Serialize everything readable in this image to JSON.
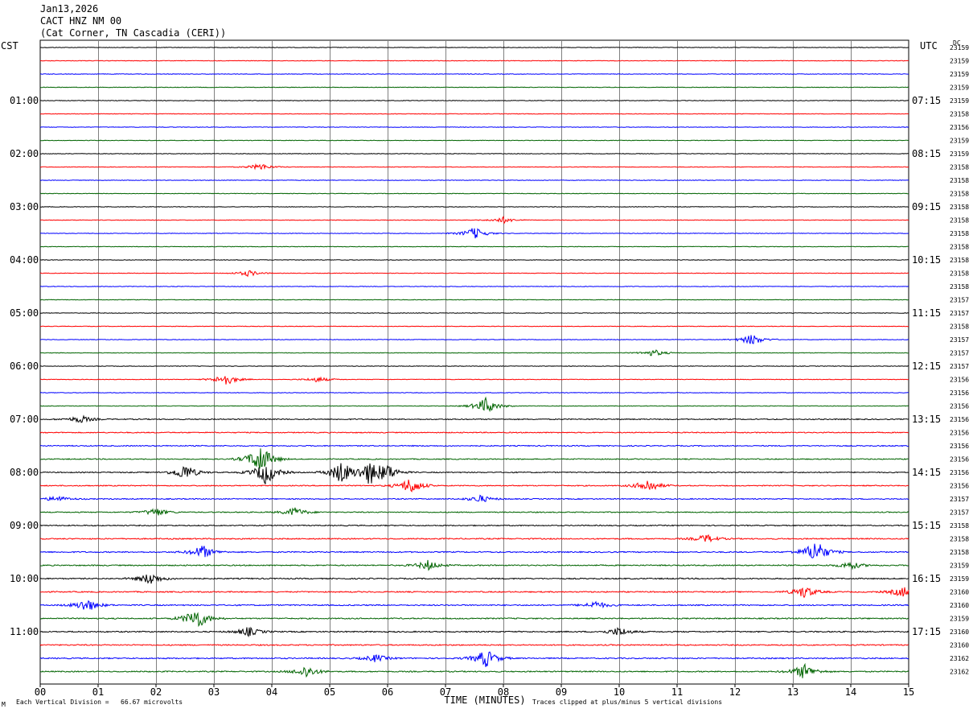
{
  "header": {
    "date": "Jan13,2026",
    "station": "CACT HNZ NM 00",
    "location": "(Cat Corner, TN Cascadia (CERI))"
  },
  "left_axis_label": "CST",
  "right_axis_label": "UTC",
  "dc_label": "DC",
  "footer": {
    "scale_note": "Each Vertical Division =   66.67 microvolts",
    "clip_note": "Traces clipped at plus/minus 5 vertical divisions",
    "corner_mark": "M"
  },
  "colors": {
    "trace_cycle": [
      "#000000",
      "#ff0000",
      "#0000ff",
      "#006400"
    ],
    "grid": "#808080",
    "background": "#ffffff"
  },
  "chart_data": {
    "type": "line",
    "title": "CACT HNZ NM 00",
    "xlabel": "TIME (MINUTES)",
    "ylabel": "",
    "xlim": [
      0,
      15
    ],
    "x_ticks": [
      "00",
      "01",
      "02",
      "03",
      "04",
      "05",
      "06",
      "07",
      "08",
      "09",
      "10",
      "11",
      "12",
      "13",
      "14",
      "15"
    ],
    "trace_count": 48,
    "left_hour_labels": [
      {
        "row": 4,
        "label": "01:00"
      },
      {
        "row": 8,
        "label": "02:00"
      },
      {
        "row": 12,
        "label": "03:00"
      },
      {
        "row": 16,
        "label": "04:00"
      },
      {
        "row": 20,
        "label": "05:00"
      },
      {
        "row": 24,
        "label": "06:00"
      },
      {
        "row": 28,
        "label": "07:00"
      },
      {
        "row": 32,
        "label": "08:00"
      },
      {
        "row": 36,
        "label": "09:00"
      },
      {
        "row": 40,
        "label": "10:00"
      },
      {
        "row": 44,
        "label": "11:00"
      }
    ],
    "right_hour_labels": [
      {
        "row": 4,
        "label": "07:15"
      },
      {
        "row": 8,
        "label": "08:15"
      },
      {
        "row": 12,
        "label": "09:15"
      },
      {
        "row": 16,
        "label": "10:15"
      },
      {
        "row": 20,
        "label": "11:15"
      },
      {
        "row": 24,
        "label": "12:15"
      },
      {
        "row": 28,
        "label": "13:15"
      },
      {
        "row": 32,
        "label": "14:15"
      },
      {
        "row": 36,
        "label": "15:15"
      },
      {
        "row": 40,
        "label": "16:15"
      },
      {
        "row": 44,
        "label": "17:15"
      }
    ],
    "dc_offsets": [
      "23159",
      "23159",
      "23159",
      "23159",
      "23159",
      "23158",
      "23156",
      "23159",
      "23159",
      "23158",
      "23158",
      "23158",
      "23158",
      "23158",
      "23158",
      "23158",
      "23158",
      "23158",
      "23158",
      "23157",
      "23157",
      "23158",
      "23157",
      "23157",
      "23157",
      "23156",
      "23156",
      "23156",
      "23156",
      "23156",
      "23156",
      "23156",
      "23156",
      "23156",
      "23157",
      "23157",
      "23158",
      "23158",
      "23158",
      "23159",
      "23159",
      "23160",
      "23160",
      "23159",
      "23160",
      "23160",
      "23162",
      "23162"
    ],
    "events": [
      {
        "row": 9,
        "minute": 3.8,
        "amp": 0.9
      },
      {
        "row": 13,
        "minute": 8.0,
        "amp": 0.8
      },
      {
        "row": 14,
        "minute": 7.5,
        "amp": 1.6
      },
      {
        "row": 17,
        "minute": 3.6,
        "amp": 0.8
      },
      {
        "row": 22,
        "minute": 12.3,
        "amp": 1.5
      },
      {
        "row": 23,
        "minute": 10.6,
        "amp": 0.9
      },
      {
        "row": 25,
        "minute": 3.2,
        "amp": 1.6
      },
      {
        "row": 25,
        "minute": 4.8,
        "amp": 0.7
      },
      {
        "row": 27,
        "minute": 7.7,
        "amp": 2.2
      },
      {
        "row": 28,
        "minute": 0.7,
        "amp": 1.0
      },
      {
        "row": 31,
        "minute": 3.8,
        "amp": 4.0
      },
      {
        "row": 32,
        "minute": 2.5,
        "amp": 2.2
      },
      {
        "row": 32,
        "minute": 3.9,
        "amp": 3.2
      },
      {
        "row": 32,
        "minute": 5.2,
        "amp": 3.0
      },
      {
        "row": 32,
        "minute": 5.7,
        "amp": 3.0
      },
      {
        "row": 32,
        "minute": 6.0,
        "amp": 1.8
      },
      {
        "row": 33,
        "minute": 6.4,
        "amp": 2.2
      },
      {
        "row": 33,
        "minute": 10.5,
        "amp": 1.8
      },
      {
        "row": 34,
        "minute": 0.3,
        "amp": 0.8
      },
      {
        "row": 34,
        "minute": 7.6,
        "amp": 1.0
      },
      {
        "row": 35,
        "minute": 2.0,
        "amp": 1.1
      },
      {
        "row": 35,
        "minute": 4.4,
        "amp": 1.2
      },
      {
        "row": 37,
        "minute": 11.5,
        "amp": 1.1
      },
      {
        "row": 38,
        "minute": 2.8,
        "amp": 1.8
      },
      {
        "row": 38,
        "minute": 13.4,
        "amp": 3.2
      },
      {
        "row": 39,
        "minute": 6.7,
        "amp": 1.3
      },
      {
        "row": 39,
        "minute": 14.0,
        "amp": 1.0
      },
      {
        "row": 40,
        "minute": 1.9,
        "amp": 1.6
      },
      {
        "row": 41,
        "minute": 13.2,
        "amp": 1.6
      },
      {
        "row": 41,
        "minute": 14.9,
        "amp": 1.4
      },
      {
        "row": 42,
        "minute": 0.8,
        "amp": 1.8
      },
      {
        "row": 42,
        "minute": 9.6,
        "amp": 1.0
      },
      {
        "row": 43,
        "minute": 2.7,
        "amp": 3.0
      },
      {
        "row": 44,
        "minute": 3.6,
        "amp": 1.2
      },
      {
        "row": 44,
        "minute": 10.0,
        "amp": 1.2
      },
      {
        "row": 46,
        "minute": 7.7,
        "amp": 2.4
      },
      {
        "row": 46,
        "minute": 5.8,
        "amp": 1.0
      },
      {
        "row": 47,
        "minute": 4.6,
        "amp": 1.6
      },
      {
        "row": 47,
        "minute": 13.2,
        "amp": 2.0
      }
    ]
  }
}
